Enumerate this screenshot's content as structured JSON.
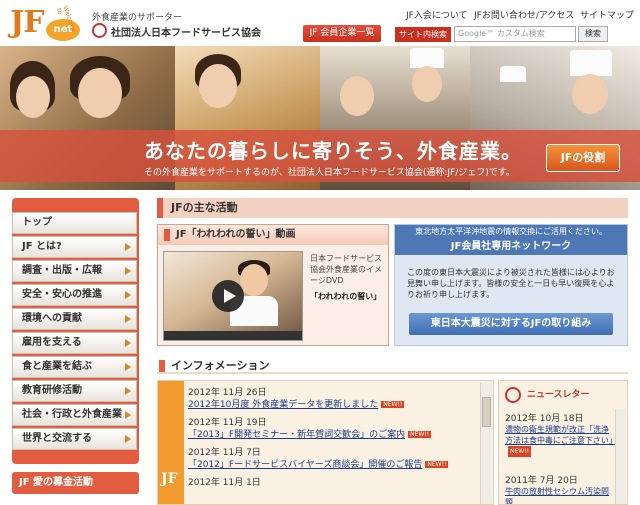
{
  "header": {
    "logo_text": "JF",
    "logo_net": "net",
    "logo_welcome": "Welcome to",
    "org_sub": "外食産業のサポーター",
    "org_name": "社団法人日本フードサービス協会",
    "links": [
      "JF入会について",
      "JFお問い合わせ/アクセス",
      "サイトマップ"
    ],
    "members_button": "JF 会員企業一覧",
    "site_search_label": "サイト内検索",
    "search_placeholder": "Google™ カスタム検索",
    "search_button": "検索"
  },
  "hero": {
    "catch": "あなたの暮らしに寄りそう、外食産業。",
    "subtext": "その外食産業をサポートするのが、社団法人日本フードサービス協会(通称:JF/ジェフ)です。",
    "role_button": "JFの役割"
  },
  "sidebar": {
    "items": [
      {
        "label": "トップ",
        "arrow": false
      },
      {
        "label": "JF とは?",
        "arrow": true
      },
      {
        "label": "調査・出版・広報",
        "arrow": true
      },
      {
        "label": "安全・安心の推進",
        "arrow": true
      },
      {
        "label": "環境への貢献",
        "arrow": true
      },
      {
        "label": "雇用を支える",
        "arrow": true
      },
      {
        "label": "食と産業を結ぶ",
        "arrow": true
      },
      {
        "label": "教育研修活動",
        "arrow": true
      },
      {
        "label": "社会・行政と外食産業",
        "arrow": true
      },
      {
        "label": "世界と交流する",
        "arrow": true
      }
    ],
    "fund_button": "JF 愛の募金活動"
  },
  "main": {
    "heading": "JFの主な活動",
    "video": {
      "title": "JF「われわれの誓い」動画",
      "desc": "日本フードサービス協会外食産業のイメージDVD",
      "name": "「われわれの誓い」"
    },
    "east": {
      "head1": "東北地方太平洋沖地震の情報交換にご活用ください。",
      "head2": "JF会員社専用ネットワーク",
      "message": "この度の東日本大震災により被災された皆様には心よりお見舞い申し上げます。皆様の安全と一日も早い復興を心よりお祈り申し上げます。",
      "button": "東日本大震災に対するJFの取り組み"
    },
    "info_heading": "インフォメーション",
    "info_tab": "JF",
    "info_items": [
      {
        "date": "2012年 11月 26日",
        "title": "2012年10月度 外食産業データを更新しました",
        "new": "NEW!!"
      },
      {
        "date": "2012年 11月 19日",
        "title": "「2013」F開発セミナー・新年賀詞交歓会」のご案内",
        "new": "NEW!!"
      },
      {
        "date": "2012年 11月 7日",
        "title": "「2012」Fードサービスバイヤーズ商談会」開催のご報告",
        "new": "NEW!!"
      },
      {
        "date": "2012年 11月 1日",
        "title": "",
        "new": ""
      }
    ],
    "newsletter": {
      "title": "ニュースレター",
      "items": [
        {
          "date": "2012年 10月 18日",
          "title": "濃物の衛生規範が改正「洗浄方法は食中毒にご注意下さい」",
          "new": "NEW!!"
        },
        {
          "date": "2011年 7月 20日",
          "title": "牛肉の放射性セシウム汚染問題",
          "new": ""
        }
      ]
    }
  }
}
